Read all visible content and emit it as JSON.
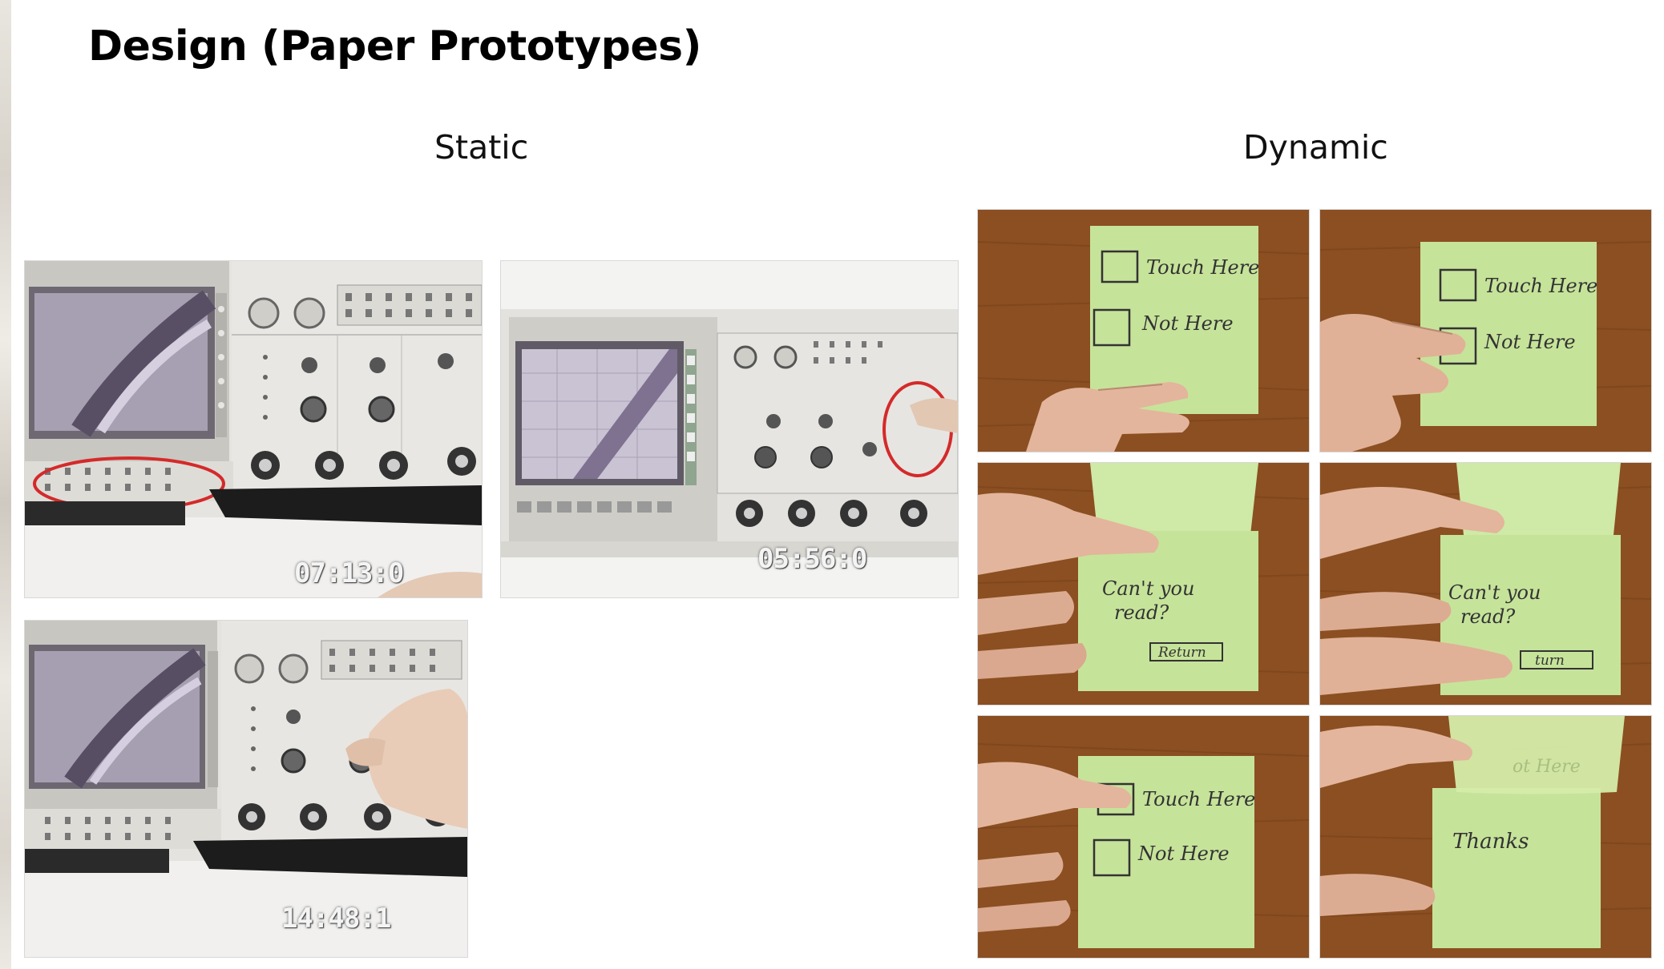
{
  "slide": {
    "title": "Design (Paper Prototypes)"
  },
  "columns": {
    "static": "Static",
    "dynamic": "Dynamic"
  },
  "static_photos": [
    {
      "timecode": "07:13:0"
    },
    {
      "timecode": "05:56:0"
    },
    {
      "timecode": "14:48:1"
    }
  ],
  "dynamic_photos": [
    {
      "lines": [
        "Touch Here",
        "Not Here"
      ]
    },
    {
      "lines": [
        "Touch Here",
        "Not Here"
      ]
    },
    {
      "lines": [
        "Can't you",
        "read?",
        "Return"
      ]
    },
    {
      "lines": [
        "Can't you",
        "read?",
        "turn"
      ]
    },
    {
      "lines": [
        "Touch Here",
        "Not Here"
      ]
    },
    {
      "lines": [
        "Thanks",
        "ot Here"
      ]
    }
  ],
  "colors": {
    "sticky": "#c6e39a",
    "wood": "#8a4e22",
    "oscilloscope": "#ecebe8"
  }
}
